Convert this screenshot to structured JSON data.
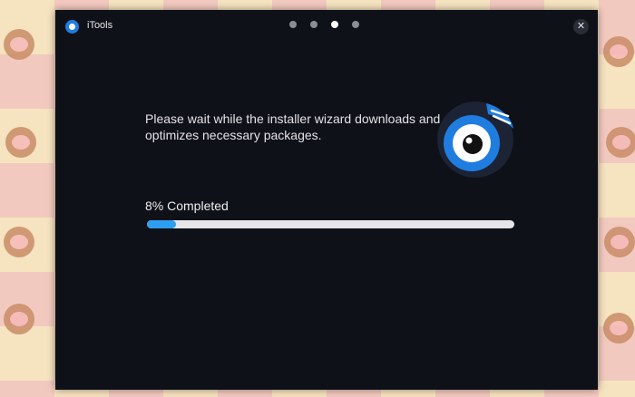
{
  "window": {
    "title": "iTools",
    "close_glyph": "✕",
    "pager": {
      "count": 4,
      "active_index": 2
    }
  },
  "installer": {
    "message": "Please wait while the installer wizard downloads and optimizes necessary packages.",
    "progress": {
      "label": "8% Completed",
      "percent": 8
    }
  },
  "icons": {
    "app": "itools-logo-icon",
    "hero": "itools-eye-logo-icon",
    "close": "close-icon"
  },
  "colors": {
    "window_bg": "#0f1119",
    "accent": "#2e9ff0",
    "track": "#e6e6e8",
    "text": "#e3e3e6"
  }
}
